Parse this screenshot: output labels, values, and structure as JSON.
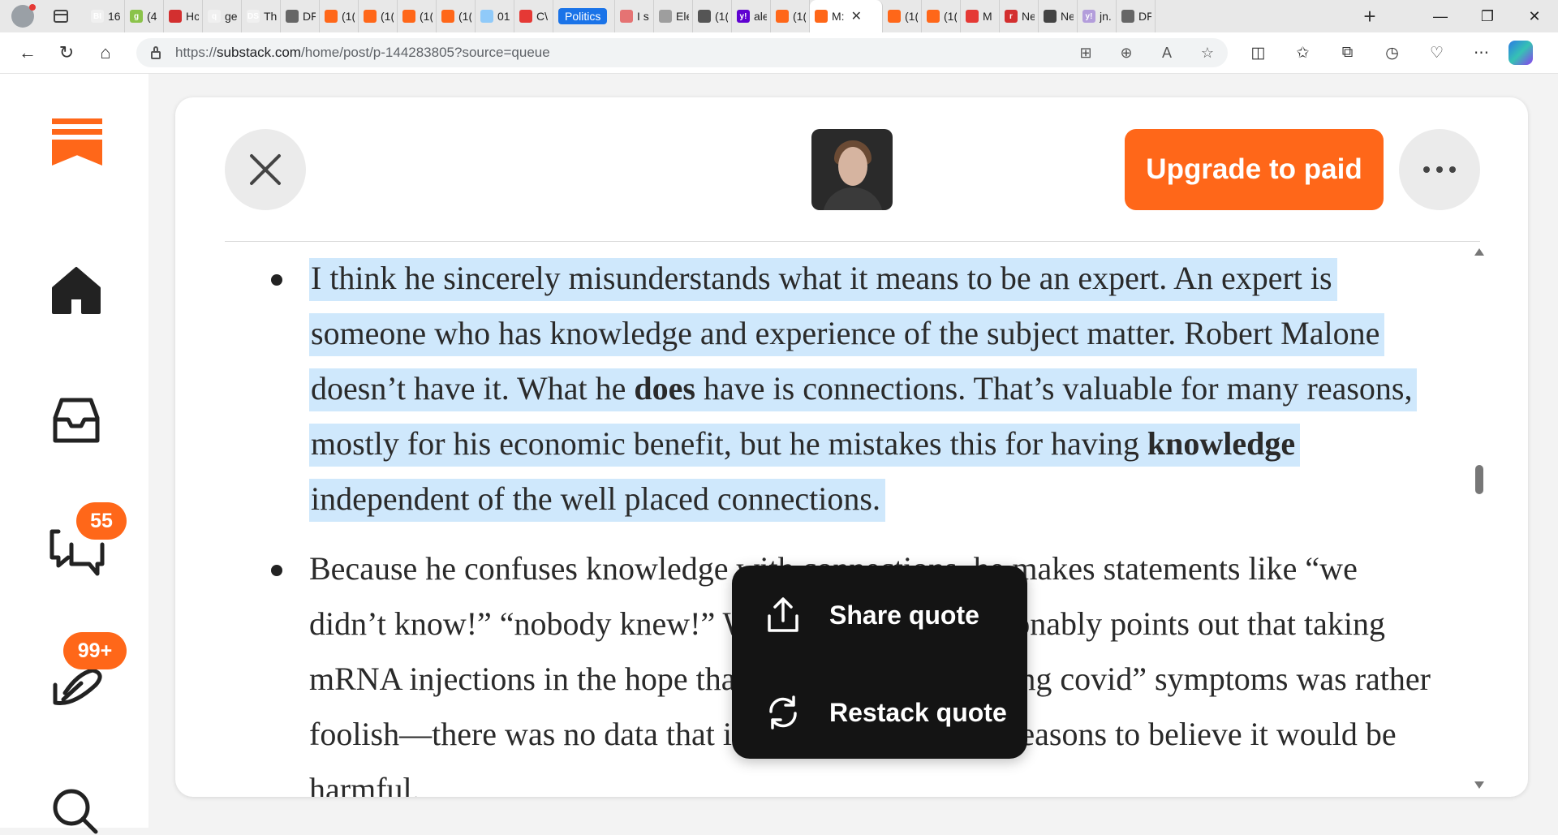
{
  "browser": {
    "tabs": [
      {
        "label": "BI",
        "title": "16",
        "color": "#f0f0f0"
      },
      {
        "label": "g",
        "title": "(4",
        "color": "#8bc34a"
      },
      {
        "label": "",
        "title": "Hc",
        "color": "#d32f2f"
      },
      {
        "label": "q",
        "title": "ge",
        "color": "#f0f0f0"
      },
      {
        "label": "DS",
        "title": "Th",
        "color": "#f0f0f0"
      },
      {
        "label": "",
        "title": "DF",
        "color": "#666666"
      },
      {
        "label": "",
        "title": "(1(",
        "color": "#ff6719"
      },
      {
        "label": "",
        "title": "(1(",
        "color": "#ff6719"
      },
      {
        "label": "",
        "title": "(1(",
        "color": "#ff6719"
      },
      {
        "label": "",
        "title": "(1(",
        "color": "#ff6719"
      },
      {
        "label": "",
        "title": "01",
        "color": "#90caf9"
      },
      {
        "label": "",
        "title": "C\\",
        "color": "#e53935"
      },
      {
        "label": "",
        "title": "Politics",
        "color": "",
        "pill": true
      },
      {
        "label": "",
        "title": "I s.",
        "color": "#e57373"
      },
      {
        "label": "",
        "title": "Ele",
        "color": "#9e9e9e"
      },
      {
        "label": "",
        "title": "(1(",
        "color": "#555555"
      },
      {
        "label": "y!",
        "title": "ale",
        "color": "#5f01d1"
      },
      {
        "label": "",
        "title": "(1(",
        "color": "#ff6719"
      },
      {
        "label": "",
        "title": "M:",
        "color": "",
        "active": true
      },
      {
        "label": "",
        "title": "(1(",
        "color": "#ff6719"
      },
      {
        "label": "",
        "title": "(1(",
        "color": "#ff6719"
      },
      {
        "label": "",
        "title": "M",
        "color": "#e53935"
      },
      {
        "label": "r",
        "title": "Ne",
        "color": "#d32f2f"
      },
      {
        "label": "",
        "title": "Ne",
        "color": "#444444"
      },
      {
        "label": "y!",
        "title": "jn.",
        "color": "#b39ddb"
      },
      {
        "label": "",
        "title": "DF",
        "color": "#666666"
      }
    ],
    "new_tab": "+",
    "window_controls": {
      "minimize": "—",
      "restore": "❐",
      "close": "✕"
    },
    "url_prefix": "https://",
    "url_host": "substack.com",
    "url_path": "/home/post/p-144283805?source=queue"
  },
  "nav": {
    "chat_badge": "55",
    "activity_badge": "99+"
  },
  "reader": {
    "upgrade_label": "Upgrade to paid",
    "bullet1": {
      "t1": "I think he sincerely misunderstands what it means to be an expert. An expert is someone who has knowledge and experience of the subject matter. Robert Malone doesn’t have it. What he ",
      "b1": "does",
      "t2": " have is connections. That’s valuable for many reasons, mostly for his economic benefit, but he mistakes this for having ",
      "b2": "knowledge",
      "t3": " independent of the well placed connections."
    },
    "bullet2": {
      "text": "Because he confuses knowledge with connections, he makes statements like “we didn’t know!” “nobody knew!” When Steve quite reasonably points out that taking mRNA injections in the hope that it would cure the “long covid” symptoms was rather foolish—there was no data that it worked and a lot of reasons to believe it would be harmful."
    }
  },
  "popup": {
    "share_label": "Share quote",
    "restack_label": "Restack quote"
  },
  "colors": {
    "accent": "#ff6719",
    "highlight": "#cfe8fc",
    "popup_bg": "#141414"
  }
}
